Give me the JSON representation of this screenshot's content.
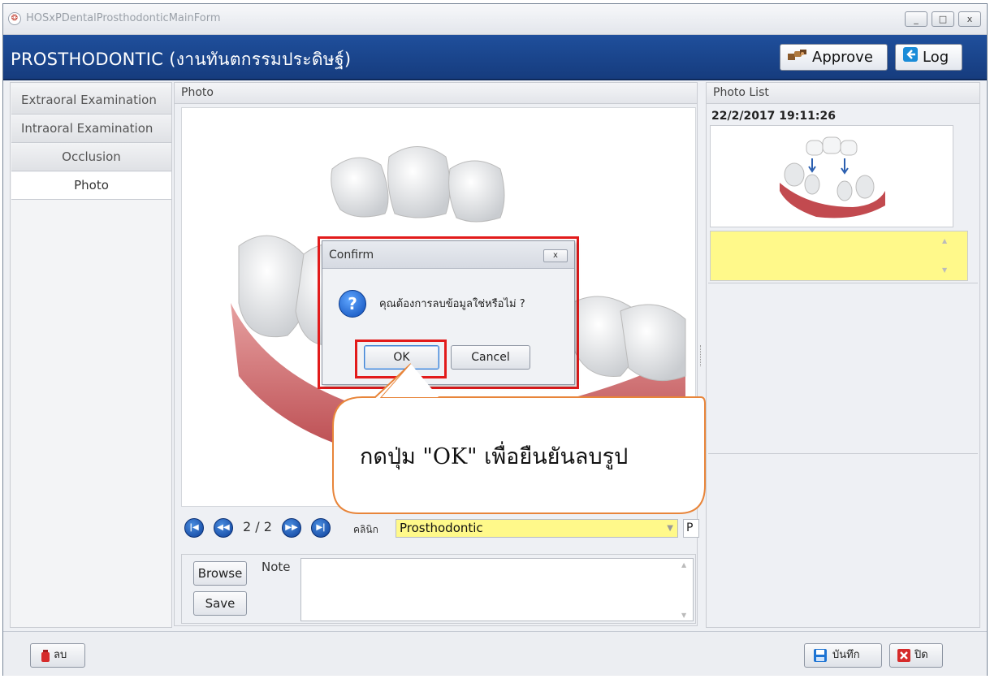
{
  "window": {
    "title": "HOSxPDentalProsthodonticMainForm",
    "minimize_label": "_",
    "maximize_label": "□",
    "close_label": "x"
  },
  "header": {
    "title": "PROSTHODONTIC (งานทันตกรรมประดิษฐ์)",
    "approve_label": "Approve",
    "log_label": "Log"
  },
  "sidebar": {
    "items": [
      {
        "label": "Extraoral Examination",
        "active": false
      },
      {
        "label": "Intraoral Examination",
        "active": false
      },
      {
        "label": "Occlusion",
        "active": false
      },
      {
        "label": "Photo",
        "active": true
      }
    ]
  },
  "photo_panel": {
    "header": "Photo",
    "counter": "2 / 2",
    "clinic_label": "คลินิก",
    "clinic_value": "Prosthodontic",
    "p_field": "P",
    "browse_label": "Browse",
    "save_label": "Save",
    "note_label": "Note",
    "note_value": ""
  },
  "photo_list": {
    "header": "Photo List",
    "entries": [
      {
        "datetime": "22/2/2017 19:11:26",
        "note": ""
      }
    ]
  },
  "bottom": {
    "delete_label": "ลบ",
    "save_label": "บันทึก",
    "close_label": "ปิด"
  },
  "dialog": {
    "title": "Confirm",
    "close_label": "x",
    "message": "คุณต้องการลบข้อมูลใช่หรือไม่ ?",
    "ok_label": "OK",
    "cancel_label": "Cancel"
  },
  "callout": {
    "text": "กดปุ่ม \"OK\" เพื่อยืนยันลบรูป"
  },
  "colors": {
    "header_bg": "#1f4f9c",
    "highlight_red": "#e21b1b",
    "callout_border": "#e8853a",
    "yellow_field": "#fff98a"
  },
  "icons": {
    "approve": "handshake-icon",
    "log": "logout-arrow-icon",
    "question": "question-icon",
    "delete": "trash-icon",
    "save": "floppy-disk-icon",
    "close": "close-x-icon"
  }
}
